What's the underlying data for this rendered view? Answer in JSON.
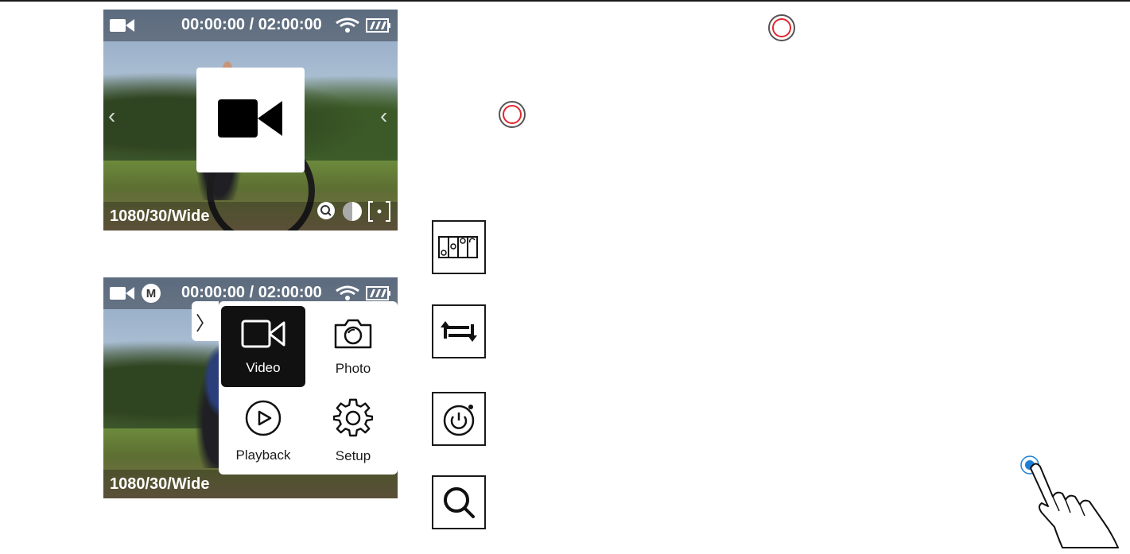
{
  "screen1": {
    "timecode": "00:00:00 / 02:00:00",
    "resolution": "1080/30/Wide",
    "icons": [
      "video-camera-icon",
      "wifi-icon",
      "battery-icon",
      "zoom-icon",
      "exposure-icon",
      "spot-metering-icon",
      "chevron-left-icon",
      "chevron-right-icon"
    ],
    "popup_icon": "video-camera-icon"
  },
  "screen2": {
    "mode_badge": "M",
    "timecode": "00:00:00 / 02:00:00",
    "resolution": "1080/30/Wide",
    "menu_handle": "〉",
    "menu": [
      {
        "label": "Video",
        "icon": "video-camera-icon",
        "active": true
      },
      {
        "label": "Photo",
        "icon": "camera-icon",
        "active": false
      },
      {
        "label": "Playback",
        "icon": "play-icon",
        "active": false
      },
      {
        "label": "Setup",
        "icon": "gear-icon",
        "active": false
      }
    ]
  },
  "symbols": {
    "record_buttons": [
      "record-button-icon",
      "record-button-icon"
    ],
    "boxed_icons": [
      "mount-icon",
      "rotate-icon",
      "power-timer-icon",
      "search-icon"
    ],
    "gesture": "tap-gesture-icon"
  },
  "colors": {
    "record_ring": "#e3262e",
    "tap_dot": "#1e7fd8",
    "menu_active": "#111111"
  }
}
